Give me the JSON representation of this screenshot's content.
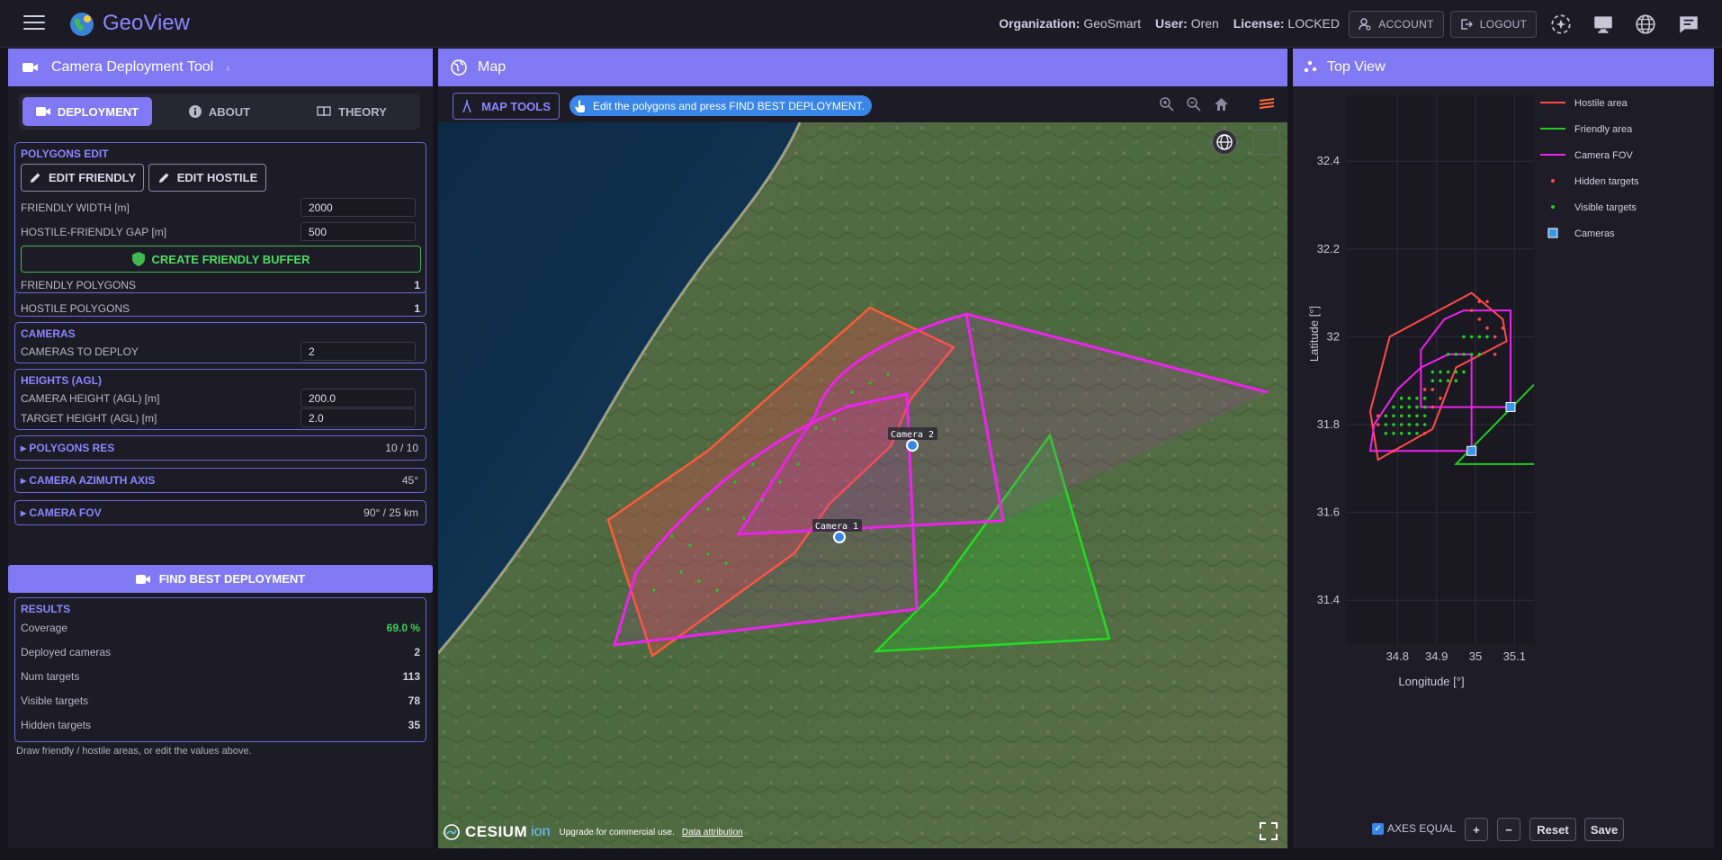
{
  "app": {
    "title": "GeoView",
    "organization_label": "Organization:",
    "organization": "GeoSmart",
    "user_label": "User:",
    "user": "Oren",
    "license_label": "License:",
    "license": "LOCKED",
    "account_label": "ACCOUNT",
    "logout_label": "LOGOUT"
  },
  "left_panel": {
    "title": "Camera Deployment Tool",
    "tabs": [
      {
        "label": "DEPLOYMENT",
        "active": true
      },
      {
        "label": "ABOUT",
        "active": false
      },
      {
        "label": "THEORY",
        "active": false
      }
    ],
    "polygons_edit": {
      "title": "POLYGONS EDIT",
      "edit_friendly_label": "EDIT FRIENDLY",
      "edit_hostile_label": "EDIT HOSTILE",
      "friendly_width_label": "FRIENDLY WIDTH [m]",
      "friendly_width_value": "2000",
      "gap_label": "HOSTILE-FRIENDLY GAP [m]",
      "gap_value": "500",
      "create_buffer_label": "CREATE FRIENDLY BUFFER",
      "friendly_polygons_label": "FRIENDLY POLYGONS",
      "friendly_polygons_value": "1",
      "hostile_polygons_label": "HOSTILE POLYGONS",
      "hostile_polygons_value": "1"
    },
    "cameras": {
      "title": "CAMERAS",
      "to_deploy_label": "CAMERAS TO DEPLOY",
      "to_deploy_value": "2"
    },
    "heights": {
      "title": "HEIGHTS (AGL)",
      "camera_height_label": "CAMERA HEIGHT (AGL) [m]",
      "camera_height_value": "200.0",
      "target_height_label": "TARGET HEIGHT (AGL) [m]",
      "target_height_value": "2.0"
    },
    "polygons_res": {
      "title": "POLYGONS RES",
      "value": "10 / 10"
    },
    "azimuth": {
      "title": "CAMERA AZIMUTH AXIS",
      "value": "45°"
    },
    "fov": {
      "title": "CAMERA FOV",
      "value": "90° / 25 km"
    },
    "find_label": "FIND BEST DEPLOYMENT",
    "results": {
      "title": "RESULTS",
      "rows": [
        {
          "label": "Coverage",
          "value": "69.0 %"
        },
        {
          "label": "Deployed cameras",
          "value": "2"
        },
        {
          "label": "Num targets",
          "value": "113"
        },
        {
          "label": "Visible targets",
          "value": "78"
        },
        {
          "label": "Hidden targets",
          "value": "35"
        }
      ]
    },
    "hint": "Draw friendly / hostile areas, or edit the values above."
  },
  "map_panel": {
    "title": "Map",
    "map_tools_label": "MAP TOOLS",
    "banner": "Edit the polygons and press FIND BEST DEPLOYMENT.",
    "camera1_label": "Camera 1",
    "camera2_label": "Camera 2",
    "cesium_brand": "CESIUM",
    "cesium_ion": "ion",
    "upgrade_text": "Upgrade for commercial use.",
    "attribution_link": "Data attribution"
  },
  "top_view": {
    "title": "Top View",
    "axes_equal_label": "AXES EQUAL",
    "axes_equal_checked": true,
    "zoom_in_label": "+",
    "zoom_out_label": "−",
    "reset_label": "Reset",
    "save_label": "Save"
  },
  "colors": {
    "accent": "#8179f4",
    "hostile": "#ff4a4a",
    "friendly": "#22cc22",
    "fov": "#ee22ee",
    "camera": "#3a96e8",
    "coverage_good": "#39d353"
  },
  "chart_data": {
    "type": "scatter",
    "xlabel": "Longitude [°]",
    "ylabel": "Latitude [°]",
    "xlim": [
      34.67,
      35.15
    ],
    "ylim": [
      31.3,
      32.55
    ],
    "xticks": [
      "34.8",
      "34.9",
      "35",
      "35.1"
    ],
    "yticks": [
      "31.4",
      "31.6",
      "31.8",
      "32",
      "32.2",
      "32.4"
    ],
    "legend_position": "top-right",
    "legend": [
      "Hostile area",
      "Friendly area",
      "Camera FOV",
      "Hidden targets",
      "Visible targets",
      "Cameras"
    ],
    "series": [
      {
        "name": "Hostile area",
        "kind": "polygon",
        "x": [
          34.78,
          34.99,
          35.07,
          35.08,
          34.95,
          34.89,
          34.75,
          34.73
        ],
        "y": [
          32.0,
          32.1,
          32.04,
          31.99,
          31.93,
          31.79,
          31.72,
          31.83
        ]
      },
      {
        "name": "Friendly area",
        "kind": "polygon",
        "x": [
          34.95,
          35.16,
          35.16,
          34.95
        ],
        "y": [
          31.71,
          31.9,
          31.71,
          31.71
        ]
      },
      {
        "name": "Camera FOV",
        "kind": "polyline",
        "x": [
          35.09,
          35.09,
          34.97,
          34.92,
          34.86,
          34.86,
          35.09
        ],
        "y": [
          31.84,
          32.06,
          32.06,
          32.04,
          31.97,
          31.84,
          31.84
        ]
      },
      {
        "name": "Camera FOV",
        "kind": "polyline",
        "x": [
          34.99,
          34.99,
          34.93,
          34.86,
          34.8,
          34.74,
          34.73,
          34.99
        ],
        "y": [
          31.74,
          31.96,
          31.96,
          31.93,
          31.88,
          31.8,
          31.74,
          31.74
        ]
      },
      {
        "name": "Cameras",
        "kind": "markers",
        "x": [
          34.99,
          35.09
        ],
        "y": [
          31.74,
          31.84
        ]
      },
      {
        "name": "Visible targets",
        "kind": "markers",
        "x": [
          34.77,
          34.79,
          34.81,
          34.83,
          34.85,
          34.77,
          34.79,
          34.81,
          34.83,
          34.85,
          34.87,
          34.77,
          34.79,
          34.81,
          34.83,
          34.85,
          34.87,
          34.79,
          34.81,
          34.83,
          34.85,
          34.87,
          34.81,
          34.83,
          34.85,
          34.87,
          34.89,
          34.91,
          34.93,
          34.95,
          34.89,
          34.91,
          34.93,
          34.95,
          34.97,
          34.93,
          34.95,
          34.97,
          34.99,
          35.01,
          34.97,
          34.99,
          35.01,
          35.03
        ],
        "y": [
          31.78,
          31.78,
          31.78,
          31.78,
          31.78,
          31.8,
          31.8,
          31.8,
          31.8,
          31.8,
          31.8,
          31.82,
          31.82,
          31.82,
          31.82,
          31.82,
          31.82,
          31.84,
          31.84,
          31.84,
          31.84,
          31.84,
          31.86,
          31.86,
          31.86,
          31.86,
          31.9,
          31.9,
          31.9,
          31.9,
          31.92,
          31.92,
          31.92,
          31.92,
          31.92,
          31.96,
          31.96,
          31.96,
          31.96,
          31.96,
          32.0,
          32.0,
          32.0,
          32.0
        ]
      },
      {
        "name": "Hidden targets",
        "kind": "markers",
        "x": [
          34.75,
          34.75,
          34.79,
          34.87,
          34.89,
          34.91,
          34.87,
          34.89,
          35.05,
          35.03,
          35.01,
          34.99,
          35.05,
          35.07,
          35.03,
          35.01
        ],
        "y": [
          31.82,
          31.8,
          31.74,
          31.78,
          31.84,
          31.86,
          31.88,
          31.88,
          31.96,
          32.02,
          32.04,
          32.06,
          32.0,
          32.02,
          32.08,
          32.08
        ]
      }
    ]
  }
}
